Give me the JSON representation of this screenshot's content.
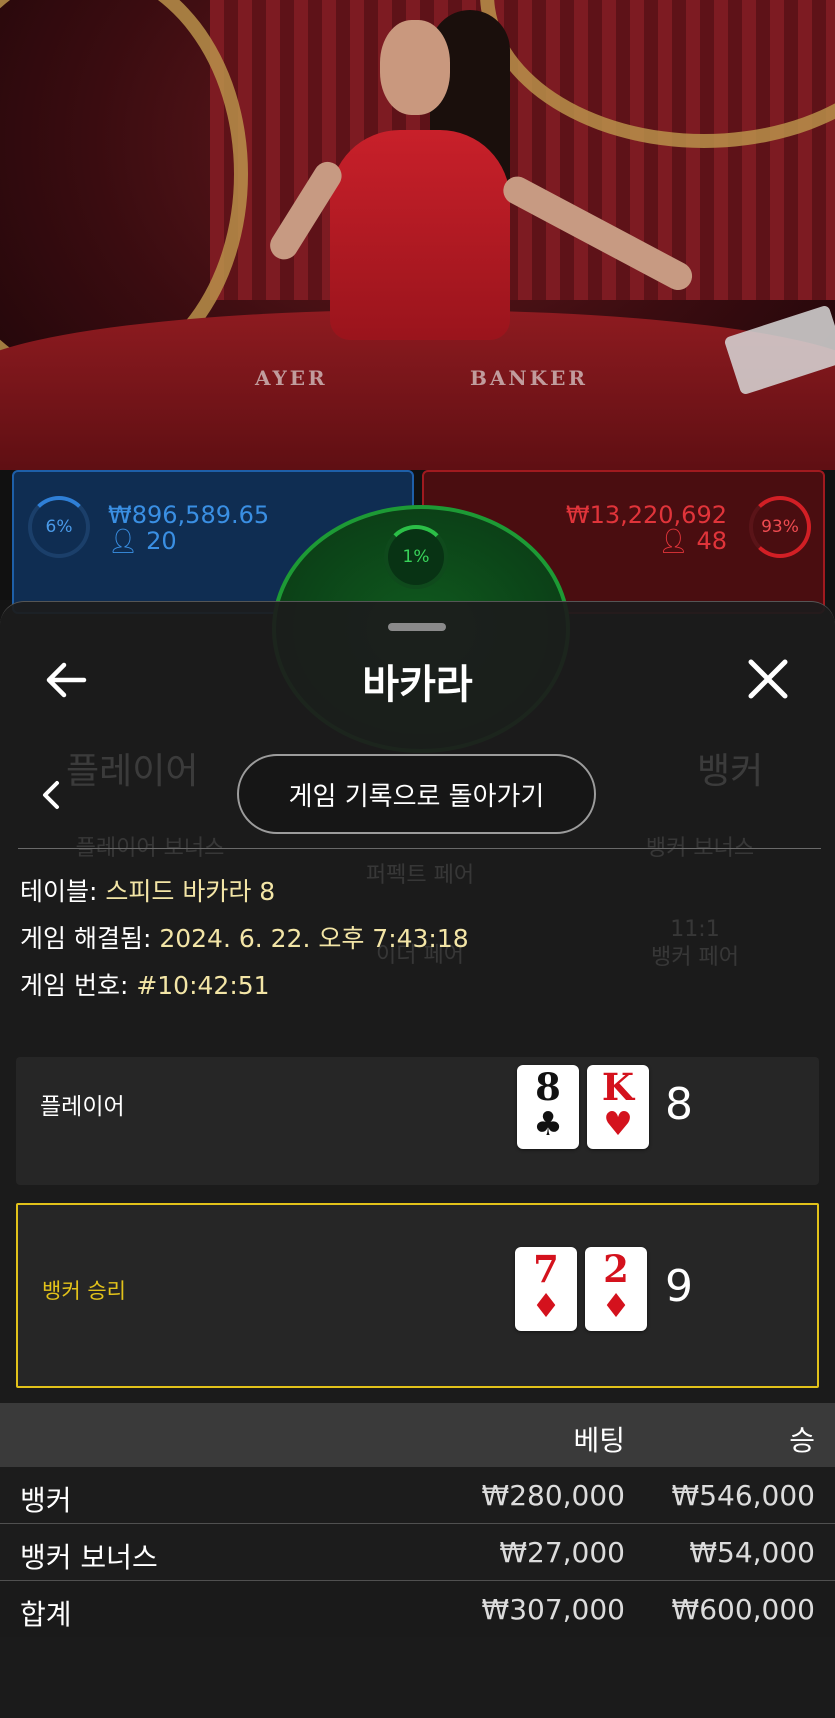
{
  "background": {
    "table_labels": [
      "AYER",
      "BANKER"
    ],
    "player_panel": {
      "percent": "6%",
      "amount": "₩896,589.65",
      "players": "20"
    },
    "banker_panel": {
      "percent": "93%",
      "amount": "₩13,220,692",
      "players": "48"
    },
    "tie_panel": {
      "percent": "1%"
    },
    "ghost_tabs": [
      "플레이어",
      "뱅커"
    ],
    "ghost_side_bets": [
      "플레이어 보너스",
      "퍼펙트 페어",
      "뱅커 보너스",
      "이더 페어",
      "11:1",
      "뱅커 페어"
    ]
  },
  "sheet": {
    "title": "바카라",
    "back_button_label": "게임 기록으로 돌아가기",
    "info": {
      "table_key": "테이블:",
      "table_value": "스피드 바카라 8",
      "resolved_key": "게임 해결됨:",
      "resolved_value": "2024. 6. 22. 오후 7:43:18",
      "number_key": "게임 번호:",
      "number_value": "#10:42:51"
    },
    "player": {
      "label": "플레이어",
      "cards": [
        {
          "rank": "8",
          "suit": "♣",
          "color": "black"
        },
        {
          "rank": "K",
          "suit": "♥",
          "color": "red"
        }
      ],
      "score": "8"
    },
    "banker": {
      "label": "뱅커 승리",
      "cards": [
        {
          "rank": "7",
          "suit": "♦",
          "color": "red"
        },
        {
          "rank": "2",
          "suit": "♦",
          "color": "red"
        }
      ],
      "score": "9"
    },
    "bets_table": {
      "headers": {
        "bet": "베팅",
        "win": "승"
      },
      "rows": [
        {
          "name": "뱅커",
          "bet": "₩280,000",
          "win": "₩546,000"
        },
        {
          "name": "뱅커 보너스",
          "bet": "₩27,000",
          "win": "₩54,000"
        },
        {
          "name": "합계",
          "bet": "₩307,000",
          "win": "₩600,000"
        }
      ]
    }
  },
  "colors": {
    "accent_gold": "#e2c21a",
    "player_blue": "#3a8fe3",
    "banker_red": "#e0343a",
    "tie_green": "#39d35a"
  }
}
